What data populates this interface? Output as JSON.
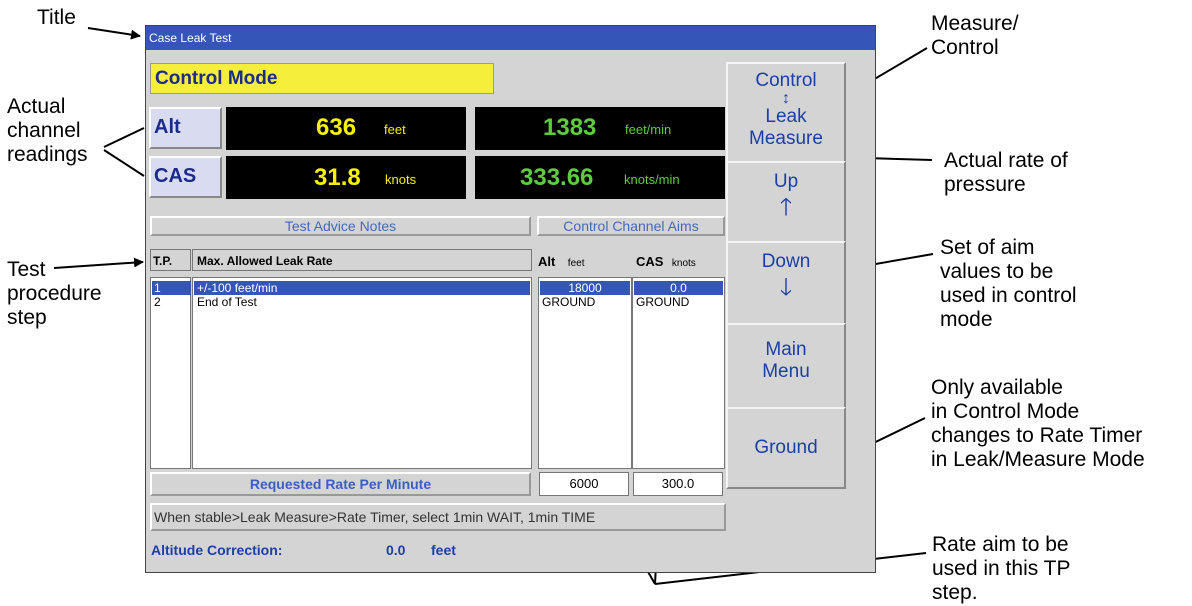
{
  "annotations": {
    "title": "Title",
    "channel_readings": [
      "Actual",
      "channel",
      "readings"
    ],
    "test_step": [
      "Test",
      "procedure",
      "step"
    ],
    "measure_control": [
      "Measure/",
      "Control"
    ],
    "rate_pressure": [
      "Actual rate of",
      "pressure"
    ],
    "aim_values": [
      "Set of aim",
      "values to be",
      "used in control",
      "mode"
    ],
    "only_available": [
      "Only available",
      "in Control Mode",
      "changes to Rate Timer",
      "in Leak/Measure Mode"
    ],
    "rate_aim": [
      "Rate aim to be",
      "used in this TP",
      "step."
    ]
  },
  "window": {
    "title": "Case Leak Test"
  },
  "mode_label": "Control Mode",
  "channels": [
    {
      "label": "Alt",
      "value": "636",
      "unit": "feet",
      "rate": "1383",
      "rate_unit": "feet/min"
    },
    {
      "label": "CAS",
      "value": "31.8",
      "unit": "knots",
      "rate": "333.66",
      "rate_unit": "knots/min"
    }
  ],
  "sections": {
    "advice": "Test Advice Notes",
    "aims": "Control Channel Aims"
  },
  "table": {
    "tp_header": "T.P.",
    "leak_header": "Max. Allowed Leak Rate",
    "alt_header": "Alt",
    "alt_unit": "feet",
    "cas_header": "CAS",
    "cas_unit": "knots",
    "rows": [
      {
        "tp": "1",
        "leak": "+/-100 feet/min",
        "alt": "18000",
        "cas": "0.0",
        "selected": true
      },
      {
        "tp": "2",
        "leak": "End of Test",
        "alt": "GROUND",
        "cas": "GROUND",
        "selected": false
      }
    ]
  },
  "requested_rate": {
    "label": "Requested Rate Per Minute",
    "alt": "6000",
    "cas": "300.0"
  },
  "status_text": "When stable>Leak Measure>Rate Timer, select 1min WAIT, 1min TIME",
  "altitude_correction": {
    "label": "Altitude Correction:",
    "value": "0.0",
    "unit": "feet"
  },
  "buttons": {
    "control": {
      "line1": "Control",
      "line2": "Leak",
      "line3": "Measure"
    },
    "up": "Up",
    "down": "Down",
    "main_menu": {
      "line1": "Main",
      "line2": "Menu"
    },
    "ground": "Ground"
  },
  "colors": {
    "titlebar": "#3556b8",
    "mode_bg": "#f5ef3c",
    "accent_text": "#1b3fa8",
    "yellow_value": "#f7f000",
    "green_value": "#5fcc3f"
  }
}
